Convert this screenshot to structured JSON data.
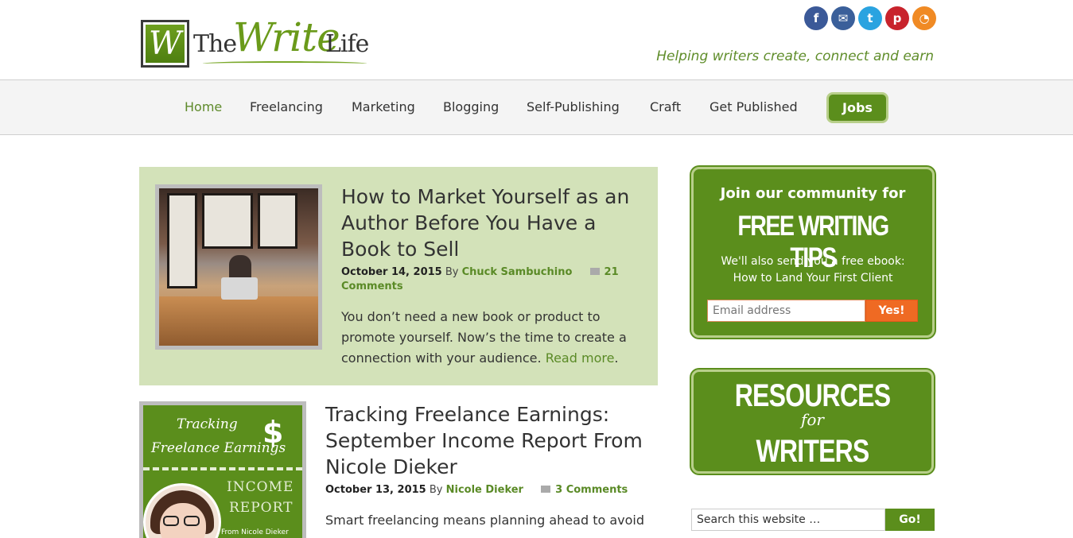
{
  "site": {
    "logo_letter": "W",
    "logo_the": "The",
    "logo_write": "Write",
    "logo_life": "Life",
    "tagline": "Helping writers create, connect and earn",
    "social": [
      {
        "name": "facebook-icon",
        "glyph": "f"
      },
      {
        "name": "chat-icon",
        "glyph": "✉"
      },
      {
        "name": "twitter-icon",
        "glyph": "t"
      },
      {
        "name": "pinterest-icon",
        "glyph": "p"
      },
      {
        "name": "rss-icon",
        "glyph": "◔"
      }
    ]
  },
  "nav": {
    "items": [
      "Home",
      "Freelancing",
      "Marketing",
      "Blogging",
      "Self-Publishing",
      "Craft",
      "Get Published"
    ],
    "jobs": "Jobs"
  },
  "posts": [
    {
      "title": "How to Market Yourself as an Author Before You Have a Book to Sell",
      "date": "October 14, 2015",
      "by": "By",
      "author": "Chuck Sambuchino",
      "comments": "21 Comments",
      "excerpt": "You don’t need a new book or product to promote yourself. Now’s the time to create a connection with your audience.",
      "read_more": "Read more",
      "period": "."
    },
    {
      "title": "Tracking Freelance Earnings: September Income Report From Nicole Dieker",
      "date": "October 13, 2015",
      "by": "By",
      "author": "Nicole Dieker",
      "comments": "3 Comments",
      "excerpt": "Smart freelancing means planning ahead to avoid",
      "thumb": {
        "line1": "Tracking",
        "line2": "Freelance Earnings",
        "dollar": "$",
        "income": "INCOME",
        "report": "REPORT",
        "from": "From Nicole Dieker"
      }
    }
  ],
  "sidebar": {
    "optin_head": "Join our community for",
    "optin_big": "FREE WRITING TIPS",
    "optin_sub1": "We'll also send you a free ebook:",
    "optin_sub2": "How to Land Your First Client",
    "email_placeholder": "Email address",
    "submit": "Yes!",
    "res_1": "RESOURCES",
    "res_2": "for",
    "res_3": "WRITERS",
    "search_value": "Search this website …",
    "search_btn": "Go!"
  },
  "colors": {
    "brand_green": "#5b8e1c",
    "post_highlight": "#d3e2b9",
    "cta_orange": "#ef6a23"
  }
}
